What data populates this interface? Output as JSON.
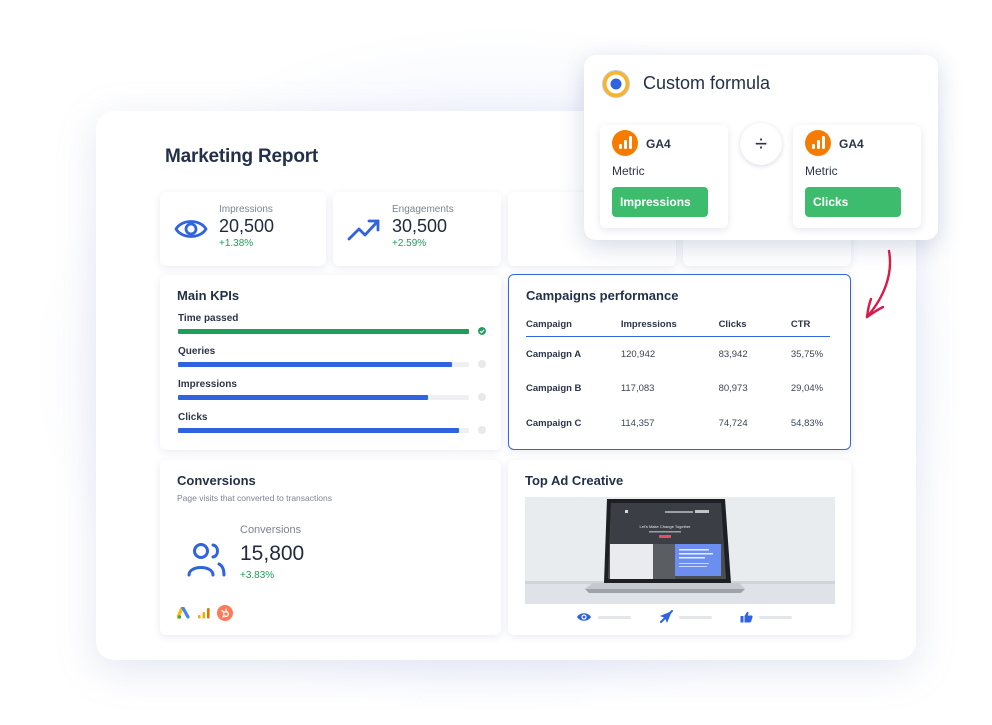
{
  "report": {
    "title": "Marketing Report"
  },
  "stats": [
    {
      "label": "Impressions",
      "value": "20,500",
      "change": "+1.38%",
      "icon": "eye-icon"
    },
    {
      "label": "Engagements",
      "value": "30,500",
      "change": "+2.59%",
      "icon": "trend-up-icon"
    }
  ],
  "kpis": {
    "title": "Main KPIs",
    "items": [
      {
        "label": "Time passed",
        "progress": 1.0,
        "color": "#1f9d5b",
        "complete": true
      },
      {
        "label": "Queries",
        "progress": 0.94,
        "color": "#2f63e0",
        "complete": false
      },
      {
        "label": "Impressions",
        "progress": 0.86,
        "color": "#2f63e0",
        "complete": false
      },
      {
        "label": "Clicks",
        "progress": 0.965,
        "color": "#2f63e0",
        "complete": false
      }
    ]
  },
  "campaigns": {
    "title": "Campaigns performance",
    "columns": [
      "Campaign",
      "Impressions",
      "Clicks",
      "CTR"
    ],
    "rows": [
      [
        "Campaign A",
        "120,942",
        "83,942",
        "35,75%"
      ],
      [
        "Campaign B",
        "117,083",
        "80,973",
        "29,04%"
      ],
      [
        "Campaign C",
        "114,357",
        "74,724",
        "54,83%"
      ]
    ]
  },
  "conversions": {
    "title": "Conversions",
    "subtitle": "Page visits that converted to transactions",
    "label": "Conversions",
    "value": "15,800",
    "change": "+3.83%",
    "sources": [
      "google-ads-icon",
      "google-analytics-icon",
      "hubspot-icon"
    ]
  },
  "ad_creative": {
    "title": "Top Ad Creative",
    "screen_headline": "Let's Make Change Together",
    "stats": [
      "eye-icon",
      "send-icon",
      "thumbs-up-icon"
    ]
  },
  "formula": {
    "title": "Custom formula",
    "operator": "÷",
    "operands": [
      {
        "source": "GA4",
        "type_label": "Metric",
        "metric": "Impressions"
      },
      {
        "source": "GA4",
        "type_label": "Metric",
        "metric": "Clicks"
      }
    ]
  },
  "colors": {
    "accent_blue": "#2f63e0",
    "positive_green": "#1f9d5b",
    "pill_green": "#3dbc6d",
    "ga_orange": "#f57c00",
    "arrow_red": "#d81b4a"
  }
}
